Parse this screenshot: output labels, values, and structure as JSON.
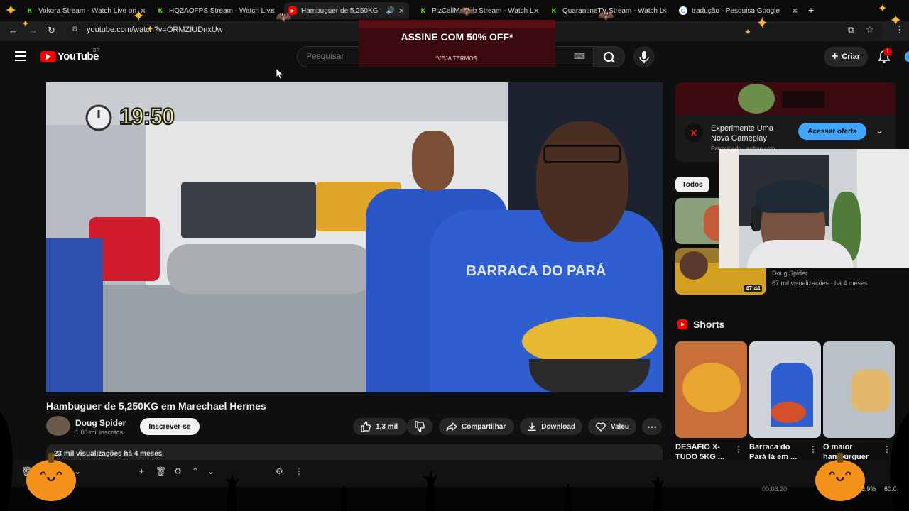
{
  "browser": {
    "tabs": [
      {
        "title": "Vokora Stream - Watch Live on",
        "icon": "kick-icon"
      },
      {
        "title": "HQZAOFPS Stream - Watch Live",
        "icon": "kick-icon"
      },
      {
        "title": "Hambuguer de 5,250KG",
        "icon": "youtube-icon"
      },
      {
        "title": "PizCallMeDub Stream - Watch L",
        "icon": "kick-icon"
      },
      {
        "title": "QuarantineTV Stream - Watch L",
        "icon": "kick-icon"
      },
      {
        "title": "tradução - Pesquisa Google",
        "icon": "google-icon"
      }
    ],
    "url": "youtube.com/watch?v=ORMZIUDnxUw"
  },
  "youtube": {
    "logo": "YouTube",
    "region": "BR",
    "search_placeholder": "Pesquisar",
    "create_label": "Criar",
    "notification_count": "1"
  },
  "top_ad": {
    "title": "ASSINE COM 50% OFF*",
    "subtitle": "*VEJA TERMOS."
  },
  "video": {
    "timer_overlay": "19:50",
    "title": "Hambuguer de 5,250KG em Marechael Hermes",
    "channel": "Doug Spider",
    "subscribers": "1,08 mil inscritos",
    "subscribe_label": "Inscrever-se",
    "likes": "1,3 mil",
    "share_label": "Compartilhar",
    "download_label": "Download",
    "thanks_label": "Valeu",
    "views_date": "23 mil visualizações  há 4 meses",
    "shirt_text": "BARRACA DO PARÁ"
  },
  "sidebar": {
    "ad": {
      "title": "Experimente Uma Nova Gameplay",
      "sponsor": "Patrocinado · axitiap.com",
      "cta": "Acessar oferta"
    },
    "chip_all": "Todos",
    "rec2": {
      "channel": "Doug Spider",
      "meta": "67 mil visualizações · há 4 meses",
      "duration": "47:44"
    },
    "shorts_title": "Shorts",
    "shorts": [
      {
        "caption": "DESAFIO X-TUDO 5KG ..."
      },
      {
        "caption": "Barraca do Pará lá em ..."
      },
      {
        "caption": "O maior hambúrguer"
      }
    ]
  },
  "status": {
    "time": "00:03:20",
    "cpu": "3.9%",
    "fps": "60.0"
  },
  "colors": {
    "yt_red": "#ff0000",
    "accent_blue": "#3ea6ff",
    "pumpkin": "#f5921b",
    "sparkle": "#f7b733"
  }
}
